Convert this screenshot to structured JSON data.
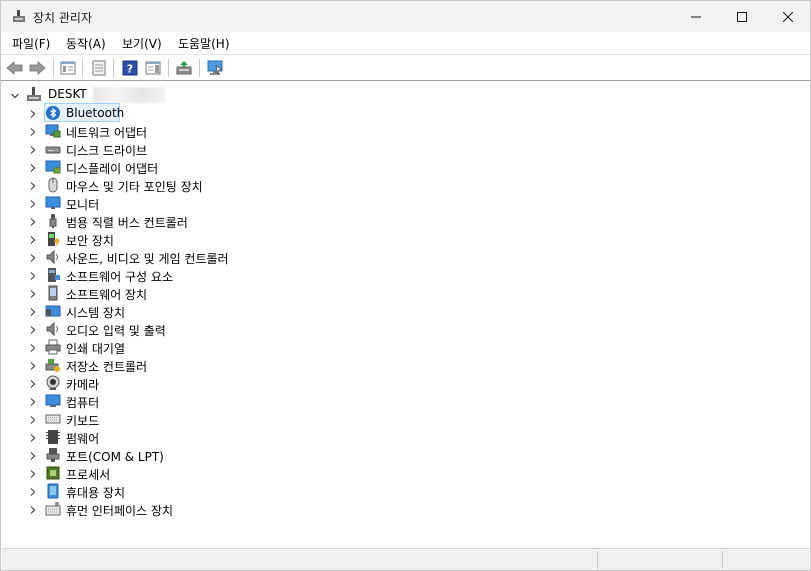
{
  "window": {
    "title": "장치 관리자",
    "icon": "device-manager-icon"
  },
  "menu": [
    {
      "label": "파일(F)"
    },
    {
      "label": "동작(A)"
    },
    {
      "label": "보기(V)"
    },
    {
      "label": "도움말(H)"
    }
  ],
  "toolbar": [
    {
      "icon": "back-arrow-icon"
    },
    {
      "icon": "forward-arrow-icon"
    },
    {
      "icon": "show-hide-console-tree-icon"
    },
    {
      "icon": "properties-icon"
    },
    {
      "icon": "help-icon"
    },
    {
      "icon": "show-action-pane-icon"
    },
    {
      "icon": "update-driver-icon"
    },
    {
      "icon": "scan-hardware-changes-icon"
    }
  ],
  "tree": {
    "root": {
      "label": "DESKT",
      "icon": "computer-tree-icon"
    },
    "categories": [
      {
        "label": "Bluetooth",
        "icon": "bluetooth-icon",
        "selected": true
      },
      {
        "label": "네트워크 어댑터",
        "icon": "network-adapter-icon"
      },
      {
        "label": "디스크 드라이브",
        "icon": "disk-drive-icon"
      },
      {
        "label": "디스플레이 어댑터",
        "icon": "display-adapter-icon"
      },
      {
        "label": "마우스 및 기타 포인팅 장치",
        "icon": "mouse-icon"
      },
      {
        "label": "모니터",
        "icon": "monitor-icon"
      },
      {
        "label": "범용 직렬 버스 컨트롤러",
        "icon": "usb-controller-icon"
      },
      {
        "label": "보안 장치",
        "icon": "security-device-icon"
      },
      {
        "label": "사운드, 비디오 및 게임 컨트롤러",
        "icon": "sound-icon"
      },
      {
        "label": "소프트웨어 구성 요소",
        "icon": "software-component-icon"
      },
      {
        "label": "소프트웨어 장치",
        "icon": "software-device-icon"
      },
      {
        "label": "시스템 장치",
        "icon": "system-device-icon"
      },
      {
        "label": "오디오 입력 및 출력",
        "icon": "audio-io-icon"
      },
      {
        "label": "인쇄 대기열",
        "icon": "print-queue-icon"
      },
      {
        "label": "저장소 컨트롤러",
        "icon": "storage-controller-icon"
      },
      {
        "label": "카메라",
        "icon": "camera-icon"
      },
      {
        "label": "컴퓨터",
        "icon": "computer-icon"
      },
      {
        "label": "키보드",
        "icon": "keyboard-icon"
      },
      {
        "label": "펌웨어",
        "icon": "firmware-icon"
      },
      {
        "label": "포트(COM & LPT)",
        "icon": "port-icon"
      },
      {
        "label": "프로세서",
        "icon": "processor-icon"
      },
      {
        "label": "휴대용 장치",
        "icon": "portable-device-icon"
      },
      {
        "label": "휴먼 인터페이스 장치",
        "icon": "hid-icon"
      }
    ]
  },
  "colors": {
    "selection_bg": "#e5f3ff",
    "selection_border": "#99d1ff",
    "titlebar_bg": "#f3f3f3",
    "monitor_blue": "#2d8ad8"
  }
}
